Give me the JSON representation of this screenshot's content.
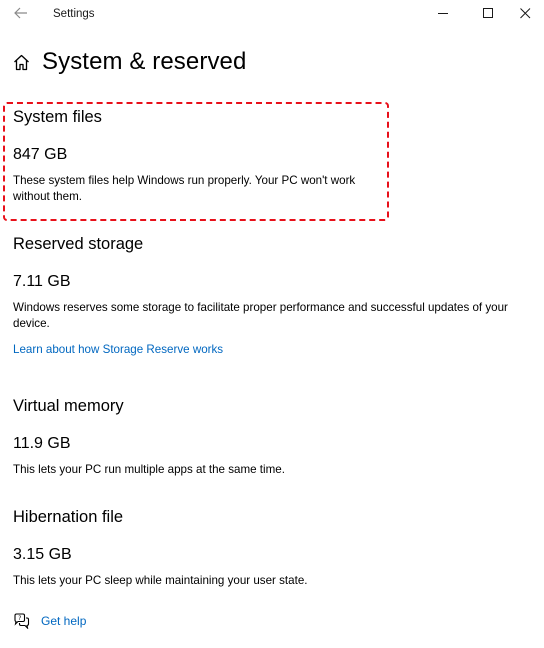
{
  "window": {
    "app_title": "Settings"
  },
  "icons": {
    "back": "back-arrow-icon",
    "minimize": "minimize-icon",
    "maximize": "maximize-icon",
    "close": "close-icon",
    "home": "home-icon",
    "help": "help-chat-icon"
  },
  "colors": {
    "highlight_border": "#e8101a",
    "link": "#0067c0"
  },
  "page": {
    "title": "System & reserved"
  },
  "sections": [
    {
      "title": "System files",
      "size": "847 GB",
      "description": "These system files help Windows run properly. Your PC won't work without them."
    },
    {
      "title": "Reserved storage",
      "size": "7.11 GB",
      "description": "Windows reserves some storage to facilitate proper performance and successful updates of your device.",
      "link": "Learn about how Storage Reserve works"
    },
    {
      "title": "Virtual memory",
      "size": "11.9 GB",
      "description": "This lets your PC run multiple apps at the same time."
    },
    {
      "title": "Hibernation file",
      "size": "3.15 GB",
      "description": "This lets your PC sleep while maintaining your user state."
    }
  ],
  "help": {
    "label": "Get help"
  }
}
